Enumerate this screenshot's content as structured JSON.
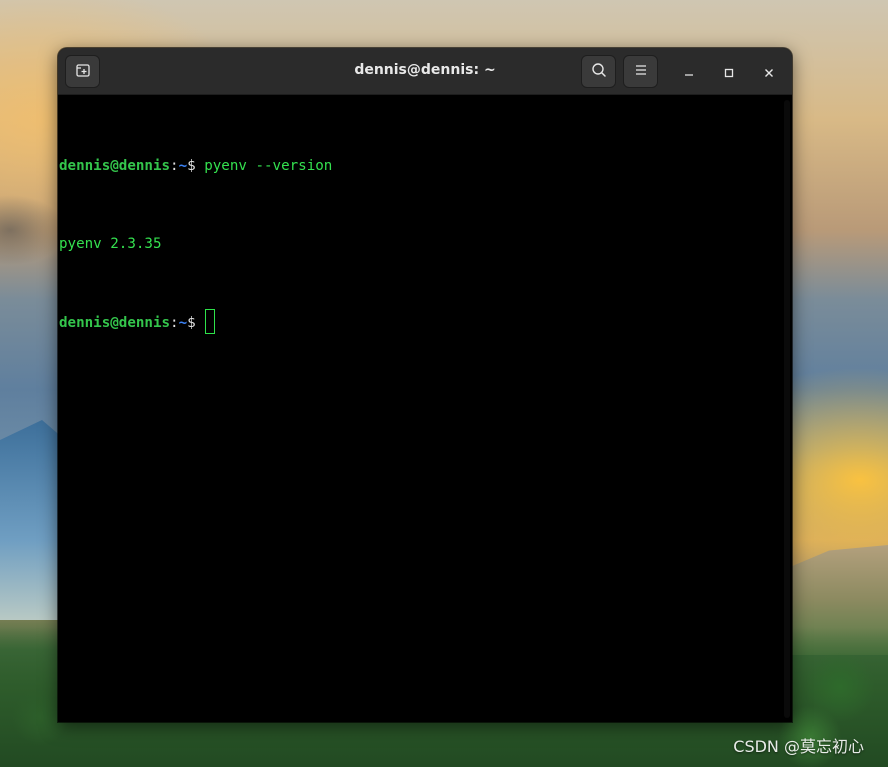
{
  "window": {
    "title": "dennis@dennis: ~"
  },
  "icons": {
    "new_tab": "new-tab-icon",
    "search": "search-icon",
    "menu": "hamburger-menu-icon",
    "minimize": "minimize-icon",
    "maximize": "maximize-icon",
    "close": "close-icon"
  },
  "terminal": {
    "lines": [
      {
        "user_host": "dennis@dennis",
        "sep": ":",
        "path": "~",
        "dollar": "$",
        "command": " pyenv --version"
      },
      {
        "output": "pyenv 2.3.35"
      },
      {
        "user_host": "dennis@dennis",
        "sep": ":",
        "path": "~",
        "dollar": "$",
        "command": " "
      }
    ]
  },
  "watermark": "CSDN @莫忘初心",
  "colors": {
    "prompt_user": "#34c54c",
    "prompt_path": "#3b82f6",
    "text": "#34e04f",
    "background": "#000000",
    "titlebar": "#2b2b2b"
  }
}
